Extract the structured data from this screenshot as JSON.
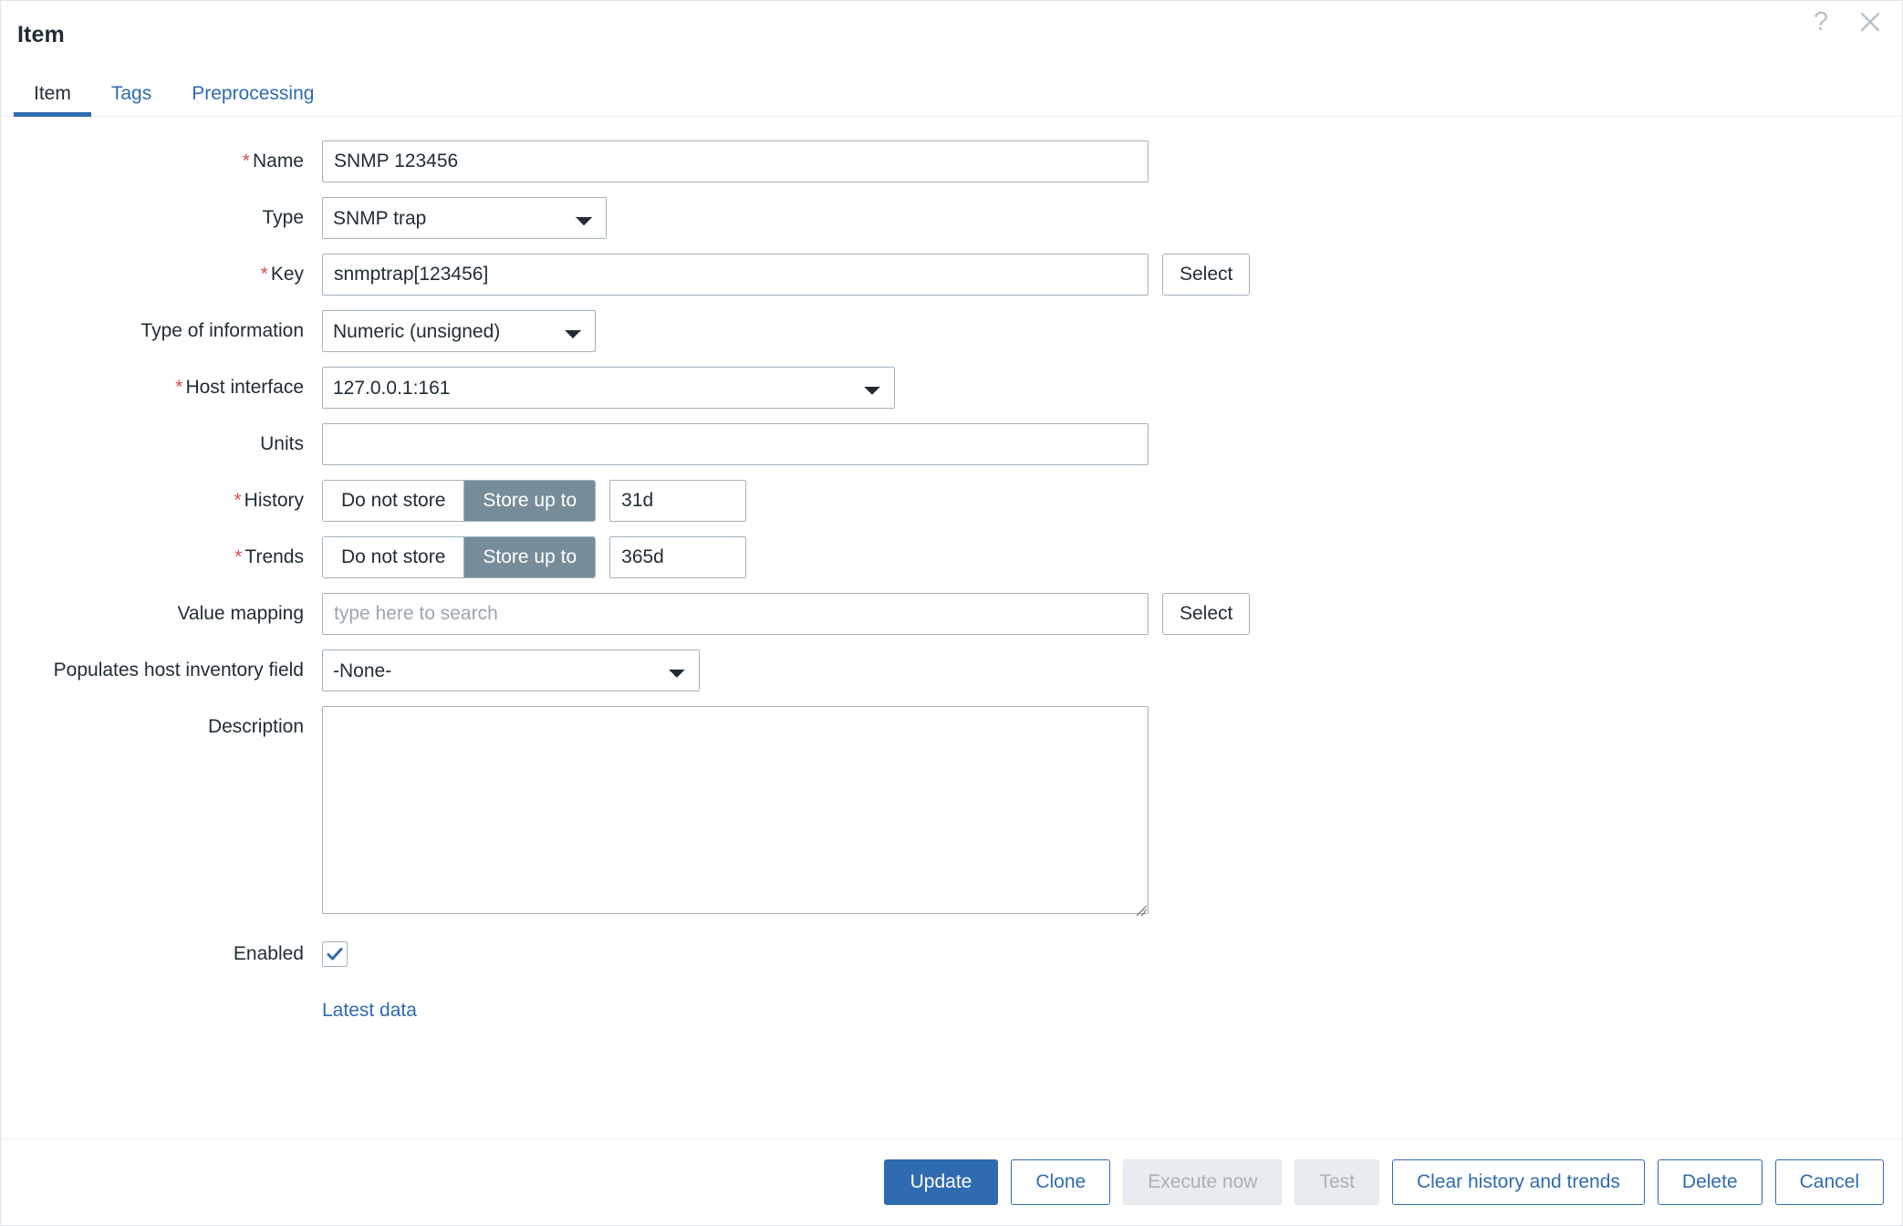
{
  "dialog": {
    "title": "Item",
    "help_icon": "question-mark-icon",
    "close_icon": "close-icon"
  },
  "tabs": [
    {
      "label": "Item",
      "active": true
    },
    {
      "label": "Tags",
      "active": false
    },
    {
      "label": "Preprocessing",
      "active": false
    }
  ],
  "form": {
    "name": {
      "label": "Name",
      "required": true,
      "value": "SNMP 123456"
    },
    "type": {
      "label": "Type",
      "required": false,
      "value": "SNMP trap",
      "options": [
        "SNMP trap"
      ]
    },
    "key": {
      "label": "Key",
      "required": true,
      "value": "snmptrap[123456]",
      "select_label": "Select"
    },
    "type_of_information": {
      "label": "Type of information",
      "required": false,
      "value": "Numeric (unsigned)",
      "options": [
        "Numeric (unsigned)"
      ]
    },
    "host_interface": {
      "label": "Host interface",
      "required": true,
      "value": "127.0.0.1:161",
      "options": [
        "127.0.0.1:161"
      ]
    },
    "units": {
      "label": "Units",
      "required": false,
      "value": ""
    },
    "history": {
      "label": "History",
      "required": true,
      "option_off": "Do not store",
      "option_on": "Store up to",
      "selected": "Store up to",
      "value": "31d"
    },
    "trends": {
      "label": "Trends",
      "required": true,
      "option_off": "Do not store",
      "option_on": "Store up to",
      "selected": "Store up to",
      "value": "365d"
    },
    "value_mapping": {
      "label": "Value mapping",
      "required": false,
      "value": "",
      "placeholder": "type here to search",
      "select_label": "Select"
    },
    "host_inventory_field": {
      "label": "Populates host inventory field",
      "required": false,
      "value": "-None-",
      "options": [
        "-None-"
      ]
    },
    "description": {
      "label": "Description",
      "required": false,
      "value": ""
    },
    "enabled": {
      "label": "Enabled",
      "checked": true
    },
    "latest_data_link": "Latest data"
  },
  "footer": {
    "update": "Update",
    "clone": "Clone",
    "execute_now": "Execute now",
    "test": "Test",
    "clear_history": "Clear history and trends",
    "delete": "Delete",
    "cancel": "Cancel"
  },
  "colors": {
    "accent": "#2e6bb0",
    "required_star": "#d64e4e",
    "segment_selected": "#768d99",
    "border": "#a3b2bd",
    "title": "#1f2c33"
  }
}
